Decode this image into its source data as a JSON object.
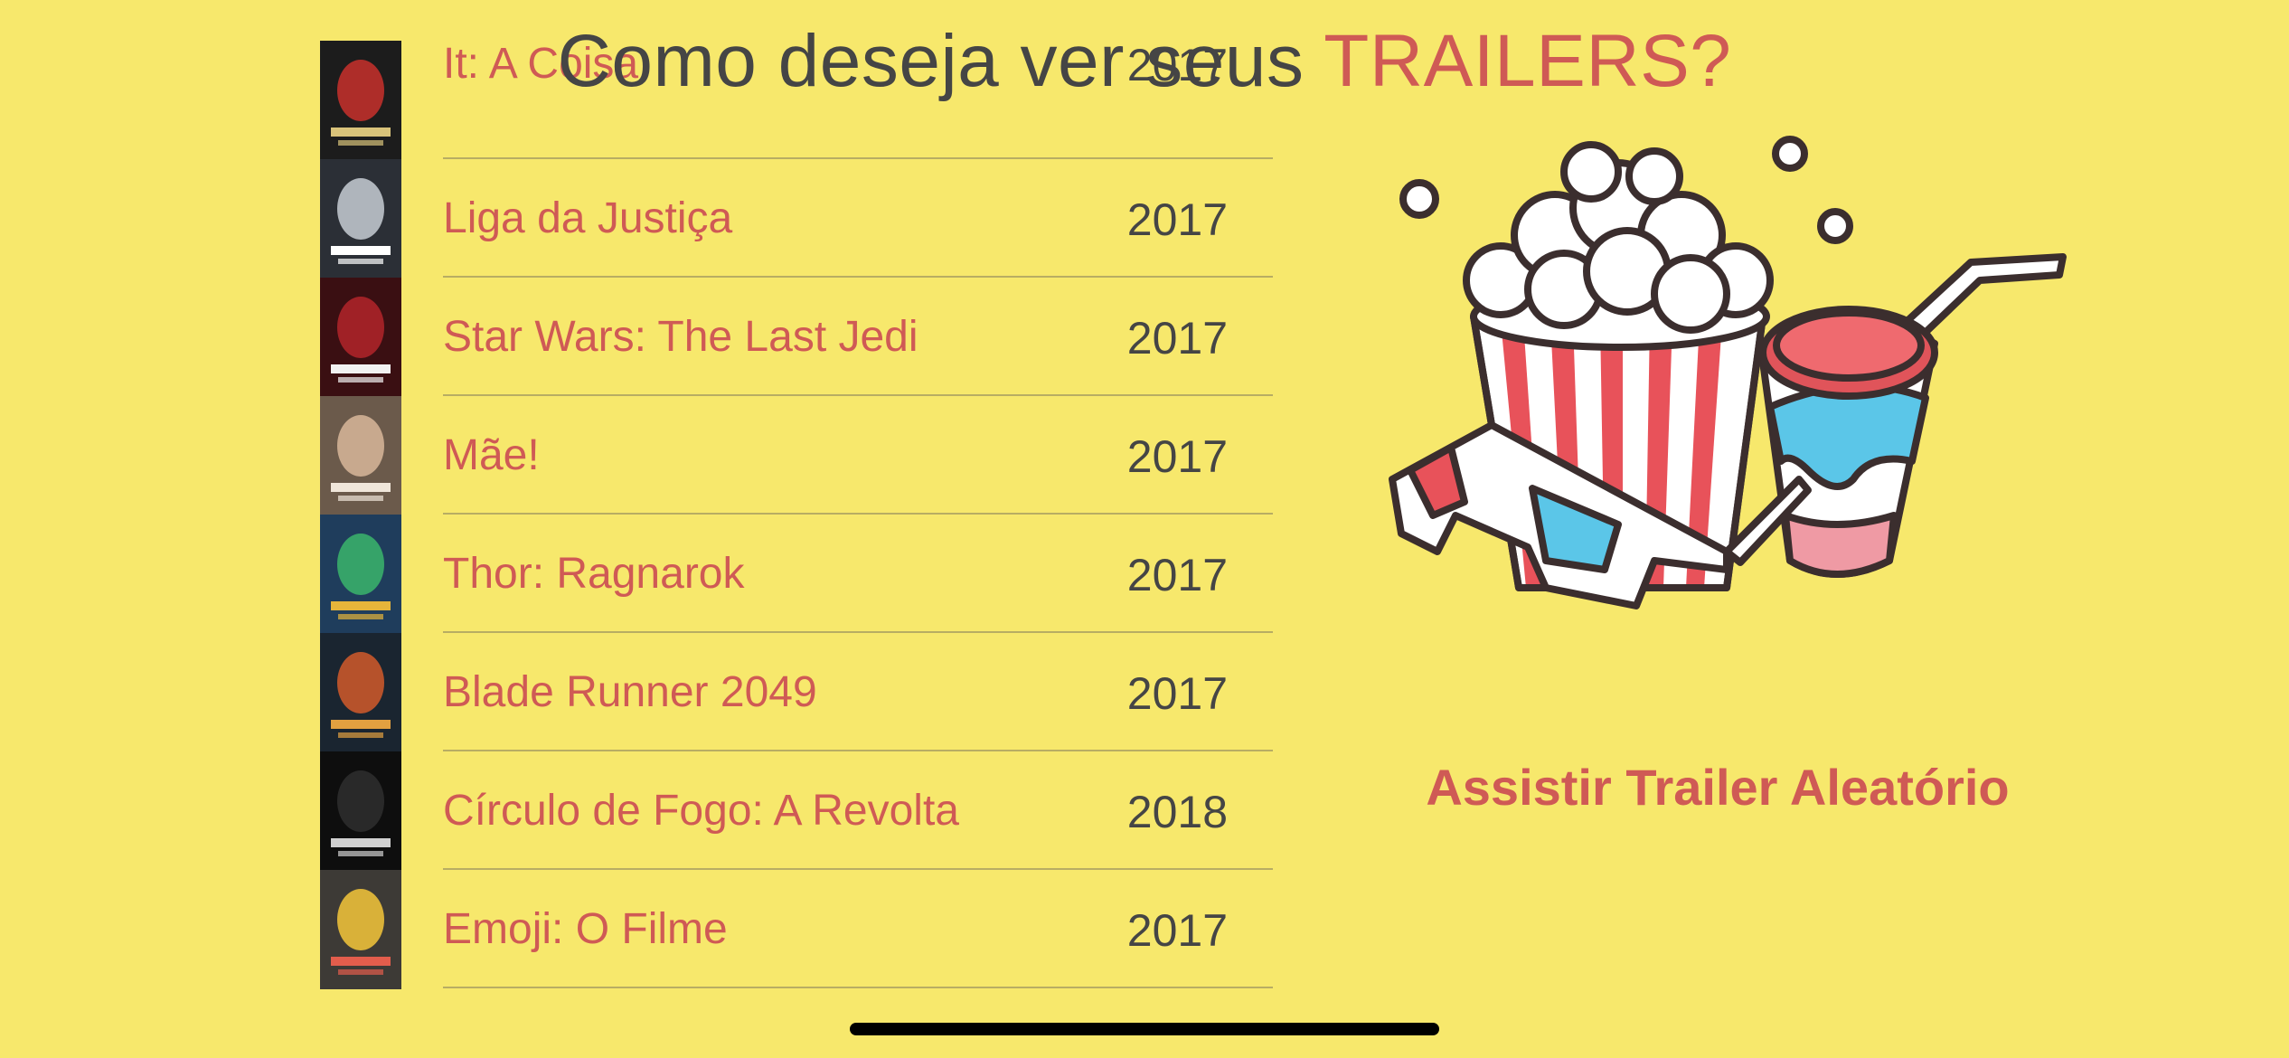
{
  "header": {
    "title_main": "Como deseja ver seus ",
    "title_accent": "TRAILERS?"
  },
  "movies": [
    {
      "title": "It: A Coisa",
      "year": "2017",
      "poster_colors": [
        "#1c1c1c",
        "#c8302b",
        "#d9c37a"
      ]
    },
    {
      "title": "Liga da Justiça",
      "year": "2017",
      "poster_colors": [
        "#2b2f36",
        "#c7ccd3",
        "#ffffff"
      ]
    },
    {
      "title": "Star Wars: The Last Jedi",
      "year": "2017",
      "poster_colors": [
        "#3a0f12",
        "#b3242a",
        "#f2f2f2"
      ]
    },
    {
      "title": "Mãe!",
      "year": "2017",
      "poster_colors": [
        "#6b5a4b",
        "#d8b79a",
        "#f0e6da"
      ]
    },
    {
      "title": "Thor: Ragnarok",
      "year": "2017",
      "poster_colors": [
        "#1f3d5c",
        "#3bb56b",
        "#e7b53a"
      ]
    },
    {
      "title": "Blade Runner 2049",
      "year": "2017",
      "poster_colors": [
        "#1a2530",
        "#d25a2a",
        "#e2a040"
      ]
    },
    {
      "title": "Círculo de Fogo: A Revolta",
      "year": "2018",
      "poster_colors": [
        "#0e0e0e",
        "#2e2e2e",
        "#d0d0d0"
      ]
    },
    {
      "title": "Emoji: O Filme",
      "year": "2017",
      "poster_colors": [
        "#3d3a36",
        "#f4c73a",
        "#e35d4c"
      ]
    }
  ],
  "actions": {
    "random_trailer_label": "Assistir Trailer Aleatório"
  },
  "colors": {
    "background": "#f7e86c",
    "accent": "#cf5a55",
    "text_dark": "#454545"
  }
}
